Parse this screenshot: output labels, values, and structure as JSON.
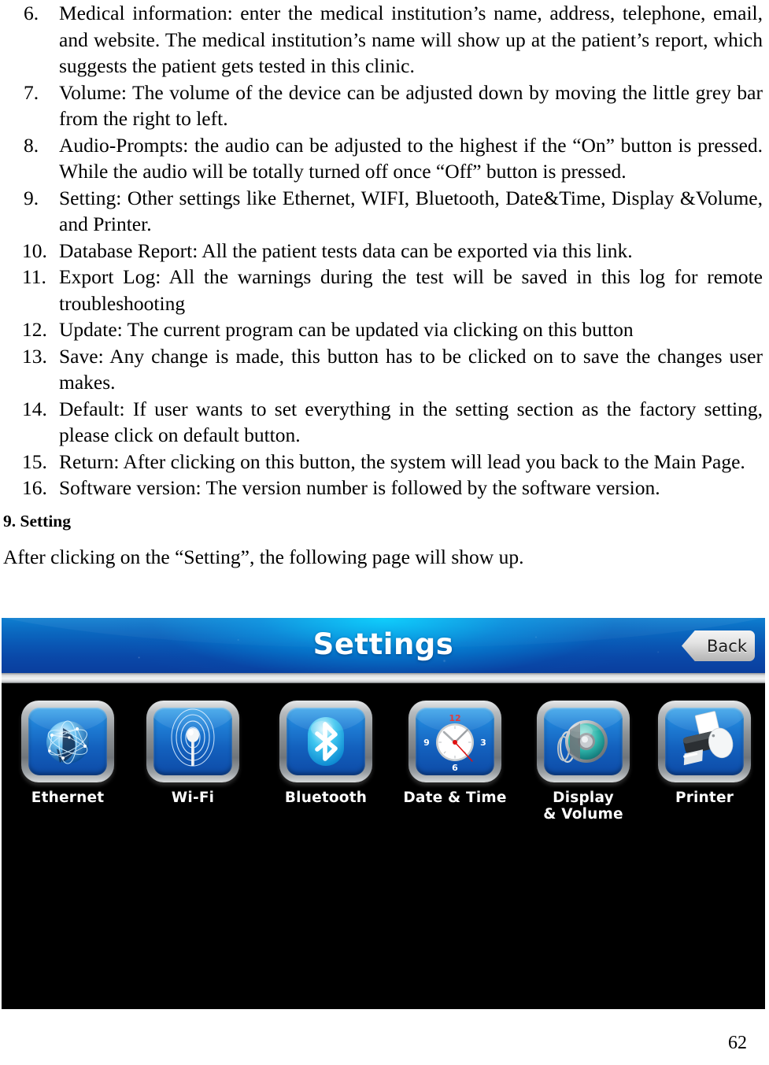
{
  "document": {
    "list_items": [
      {
        "number": "6.",
        "text": "Medical information: enter the medical institution’s name, address, telephone, email, and website. The medical institution’s name will show up at the patient’s report, which suggests the patient gets tested in this clinic."
      },
      {
        "number": "7.",
        "text": "Volume: The volume of the device can be adjusted down by moving the little grey bar from the right to left."
      },
      {
        "number": "8.",
        "text": "Audio-Prompts: the audio can be adjusted to the highest if the “On” button is pressed. While the audio will be totally turned off once “Off” button is pressed."
      },
      {
        "number": "9.",
        "text": "Setting: Other settings like Ethernet, WIFI, Bluetooth, Date&Time, Display &Volume, and Printer."
      },
      {
        "number": "10.",
        "text": "Database Report:  All the patient tests data can be exported via this link."
      },
      {
        "number": "11.",
        "text": "Export Log: All the warnings during the test will be saved in this log for remote troubleshooting"
      },
      {
        "number": "12.",
        "text": "Update: The current program can be updated via clicking on this button"
      },
      {
        "number": "13.",
        "text": "Save: Any change is made, this button has to be clicked on to save the changes user makes."
      },
      {
        "number": "14.",
        "text": "Default: If user wants to set everything in the setting section as the factory setting, please click on default button."
      },
      {
        "number": "15.",
        "text": "Return: After clicking on this button, the system will lead you back to the Main Page."
      },
      {
        "number": "16.",
        "text": "Software version: The version number is followed by the software version."
      }
    ],
    "section_heading": "9. Setting",
    "intro_paragraph": "After clicking on the “Setting”, the following page will show up.",
    "page_number": "62"
  },
  "device_screenshot": {
    "header": {
      "title": "Settings",
      "back_label": "Back",
      "background_color": "#0a52b0",
      "accent_color": "#00c8ff"
    },
    "canvas_background": "#000000",
    "icons": [
      {
        "label": "Ethernet",
        "icon": "globe-network-icon"
      },
      {
        "label": "Wi-Fi",
        "icon": "wifi-antenna-icon"
      },
      {
        "label": "Bluetooth",
        "icon": "bluetooth-icon"
      },
      {
        "label": "Date & Time",
        "icon": "analog-clock-icon"
      },
      {
        "label": "Display\n& Volume",
        "icon": "speaker-icon"
      },
      {
        "label": "Printer",
        "icon": "printer-icon"
      }
    ],
    "clock_numerals": {
      "twelve": "12",
      "three": "3",
      "six": "6",
      "nine": "9"
    }
  }
}
